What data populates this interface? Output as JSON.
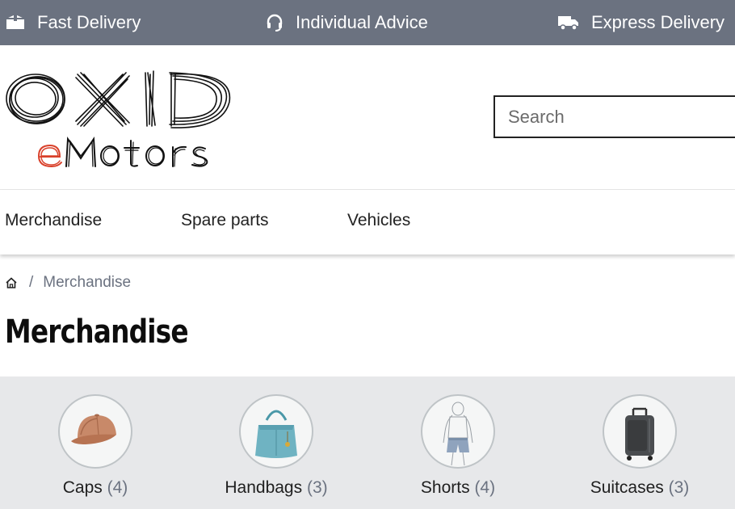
{
  "topbar": {
    "features": [
      {
        "label": "Fast Delivery",
        "icon": "box-icon"
      },
      {
        "label": "Individual Advice",
        "icon": "headset-icon"
      },
      {
        "label": "Express Delivery",
        "icon": "truck-icon"
      }
    ]
  },
  "logo": {
    "line1": "OXID",
    "line2": "eMotors"
  },
  "search": {
    "placeholder": "Search",
    "value": ""
  },
  "nav": {
    "items": [
      "Merchandise",
      "Spare parts",
      "Vehicles"
    ]
  },
  "breadcrumb": {
    "home_icon": "home-icon",
    "separator": "/",
    "current": "Merchandise"
  },
  "page": {
    "title": "Merchandise"
  },
  "categories": [
    {
      "name": "Caps",
      "count": "(4)",
      "icon": "cap-image"
    },
    {
      "name": "Handbags",
      "count": "(3)",
      "icon": "handbag-image"
    },
    {
      "name": "Shorts",
      "count": "(4)",
      "icon": "shorts-image"
    },
    {
      "name": "Suitcases",
      "count": "(3)",
      "icon": "suitcase-image"
    }
  ],
  "colors": {
    "topbar": "#6b7280",
    "category_strip": "#e7e8ea",
    "logo_accent": "#d9412b"
  }
}
